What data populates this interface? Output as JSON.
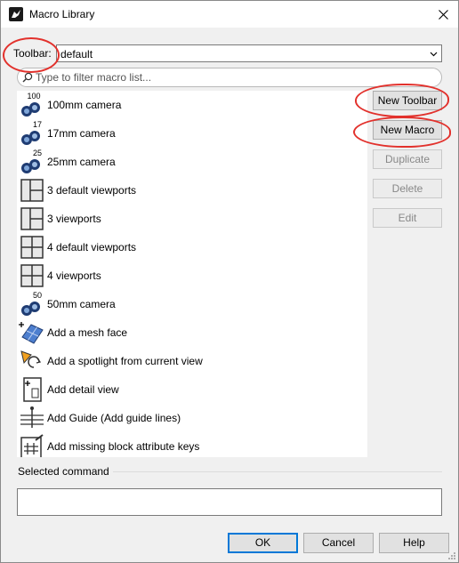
{
  "window": {
    "title": "Macro Library"
  },
  "toolbar": {
    "label": "Toolbar:",
    "selected": "default"
  },
  "filter": {
    "placeholder": "Type to filter macro list..."
  },
  "macros": [
    {
      "label": "100mm camera",
      "icon": "camera-icon",
      "badge": "100"
    },
    {
      "label": "17mm camera",
      "icon": "camera-icon",
      "badge": "17"
    },
    {
      "label": "25mm camera",
      "icon": "camera-icon",
      "badge": "25"
    },
    {
      "label": "3 default viewports",
      "icon": "three-viewports-icon"
    },
    {
      "label": "3 viewports",
      "icon": "three-viewports-icon"
    },
    {
      "label": "4 default viewports",
      "icon": "four-viewports-icon"
    },
    {
      "label": "4 viewports",
      "icon": "four-viewports-icon"
    },
    {
      "label": "50mm camera",
      "icon": "camera-icon",
      "badge": "50"
    },
    {
      "label": "Add a mesh face",
      "icon": "mesh-face-icon"
    },
    {
      "label": "Add a spotlight from current view",
      "icon": "spotlight-icon"
    },
    {
      "label": "Add detail view",
      "icon": "detail-view-icon"
    },
    {
      "label": "Add Guide (Add guide lines)",
      "icon": "guide-lines-icon"
    },
    {
      "label": "Add missing block attribute keys",
      "icon": "block-attribute-icon"
    }
  ],
  "side_buttons": {
    "new_toolbar": "New Toolbar",
    "new_macro": "New Macro",
    "duplicate": "Duplicate",
    "delete": "Delete",
    "edit": "Edit"
  },
  "selected_command": {
    "label": "Selected command",
    "value": ""
  },
  "footer": {
    "ok": "OK",
    "cancel": "Cancel",
    "help": "Help"
  },
  "colors": {
    "annotation": "#e2312c",
    "accent": "#0078d7"
  }
}
